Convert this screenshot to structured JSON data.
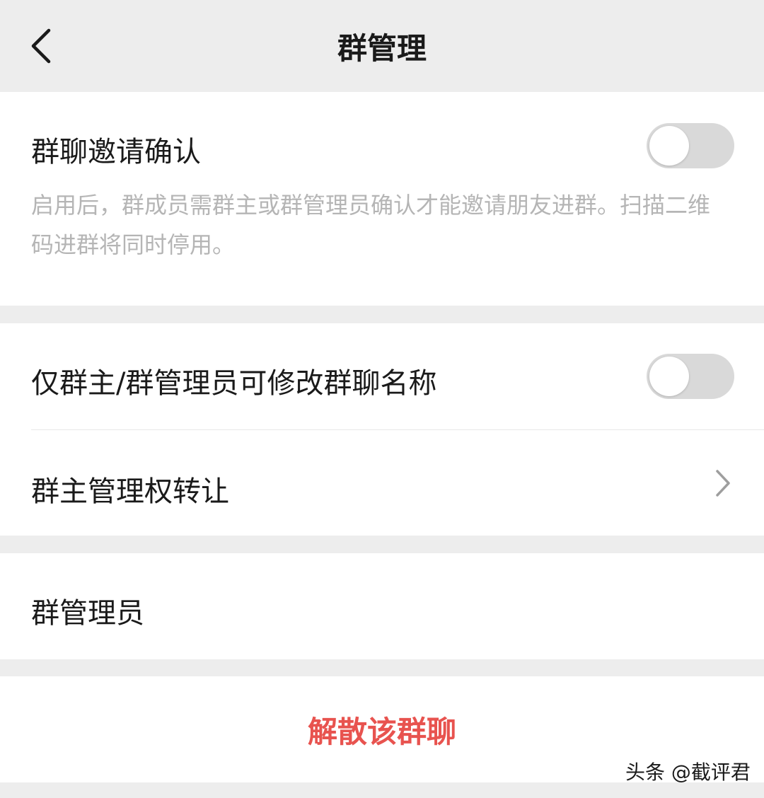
{
  "header": {
    "title": "群管理",
    "back_icon": "chevron-left-icon"
  },
  "invite_confirm": {
    "label": "群聊邀请确认",
    "description": "启用后，群成员需群主或群管理员确认才能邀请朋友进群。扫描二维码进群将同时停用。",
    "enabled": false
  },
  "rename_permission": {
    "label": "仅群主/群管理员可修改群聊名称",
    "enabled": false
  },
  "transfer_owner": {
    "label": "群主管理权转让",
    "icon": "chevron-right-icon"
  },
  "admins": {
    "label": "群管理员"
  },
  "dissolve": {
    "label": "解散该群聊"
  },
  "watermark": {
    "text": "头条 @截评君"
  },
  "colors": {
    "background": "#ededed",
    "card": "#ffffff",
    "danger": "#e8534f",
    "toggle_off": "#d9d9d9",
    "muted_text": "#b5b5b5"
  }
}
